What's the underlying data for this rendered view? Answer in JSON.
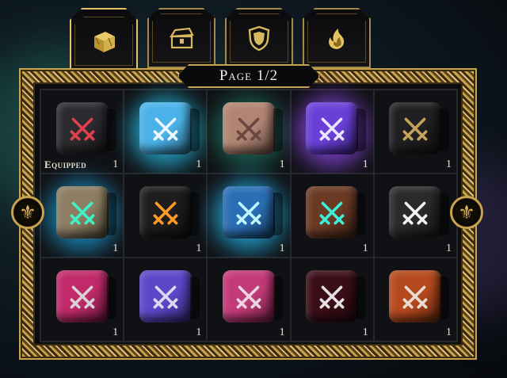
{
  "tabs": [
    {
      "name": "tab-dice",
      "icon": "cube-icon",
      "active": true
    },
    {
      "name": "tab-chests",
      "icon": "chest-icon",
      "active": false
    },
    {
      "name": "tab-shields",
      "icon": "shield-icon",
      "active": false
    },
    {
      "name": "tab-effects",
      "icon": "flame-icon",
      "active": false
    }
  ],
  "page": {
    "label": "Page 1/2"
  },
  "nav": {
    "prev_icon": "fleur-de-lis-icon",
    "next_icon": "fleur-de-lis-icon",
    "glyph": "⚜"
  },
  "dice": [
    {
      "color": "#2b2a2e",
      "glow": "",
      "swords": "#e0414f",
      "count": "1",
      "equipped": "Equipped"
    },
    {
      "color": "#4ab2e8",
      "glow": "#2bd2ff",
      "swords": "#eef6ff",
      "count": "1"
    },
    {
      "color": "#b18574",
      "glow": "#1f7a66",
      "swords": "#6a4740",
      "count": "1"
    },
    {
      "color": "#6a3fd8",
      "glow": "#9b4dff",
      "swords": "#e9e4ff",
      "count": "1"
    },
    {
      "color": "#202022",
      "glow": "",
      "swords": "#c6a25a",
      "count": "1"
    },
    {
      "color": "#8c7d63",
      "glow": "#1ea8e6",
      "swords": "#3ff2c6",
      "count": "1"
    },
    {
      "color": "#1e1c1c",
      "glow": "",
      "swords": "#ff9a28",
      "count": "1"
    },
    {
      "color": "#2a6fb3",
      "glow": "#27c5ff",
      "swords": "#bff6ff",
      "count": "1"
    },
    {
      "color": "#6a3a24",
      "glow": "",
      "swords": "#3ef0d8",
      "count": "1"
    },
    {
      "color": "#2a2a2c",
      "glow": "",
      "swords": "#f4f4f4",
      "count": "1"
    },
    {
      "color": "#c02a6a",
      "glow": "",
      "swords": "#d9d2d6",
      "count": "1"
    },
    {
      "color": "#5b48c8",
      "glow": "",
      "swords": "#dcd8ee",
      "count": "1"
    },
    {
      "color": "#c23a78",
      "glow": "",
      "swords": "#ead6e0",
      "count": "1"
    },
    {
      "color": "#3a0e18",
      "glow": "",
      "swords": "#e6e0e2",
      "count": "1"
    },
    {
      "color": "#b5491e",
      "glow": "",
      "swords": "#e8dcd4",
      "count": "1"
    }
  ]
}
